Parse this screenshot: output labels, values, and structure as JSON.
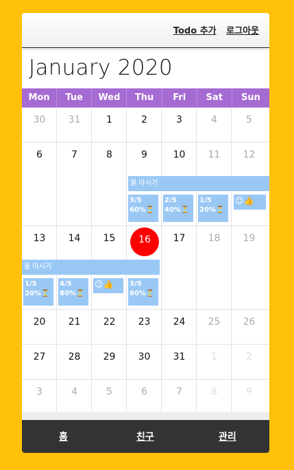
{
  "header": {
    "add_todo": "Todo 추가",
    "logout": "로그아웃"
  },
  "calendar": {
    "title": "January 2020",
    "weekdays": [
      "Mon",
      "Tue",
      "Wed",
      "Thu",
      "Fri",
      "Sat",
      "Sun"
    ],
    "weeks": [
      [
        "30",
        "31",
        "1",
        "2",
        "3",
        "4",
        "5"
      ],
      [
        "6",
        "7",
        "8",
        "9",
        "10",
        "11",
        "12"
      ],
      [
        "13",
        "14",
        "15",
        "16",
        "17",
        "18",
        "19"
      ],
      [
        "20",
        "21",
        "22",
        "23",
        "24",
        "25",
        "26"
      ],
      [
        "27",
        "28",
        "29",
        "30",
        "31",
        "1",
        "2"
      ],
      [
        "3",
        "4",
        "5",
        "6",
        "7",
        "8",
        "9"
      ]
    ],
    "events": {
      "water_week2": "물 마시기",
      "water_week3": "물 마시기",
      "w2_thu": "3/5\n60%⏳",
      "w2_fri": "2/5\n40%⏳",
      "w2_sat": "1/5\n20%⏳",
      "w2_sun": "😉👍",
      "w3_mon": "1/5\n20%⏳",
      "w3_tue": "4/5\n80%⏳",
      "w3_wed": "😉👍",
      "w3_thu": "3/5\n60%⏳"
    }
  },
  "nav": {
    "home": "홈",
    "friends": "친구",
    "manage": "관리"
  },
  "colors": {
    "background": "#FFC107",
    "weekday_bar": "#A66BD2",
    "event": "#9AC8F5",
    "today": "#FF0000"
  }
}
